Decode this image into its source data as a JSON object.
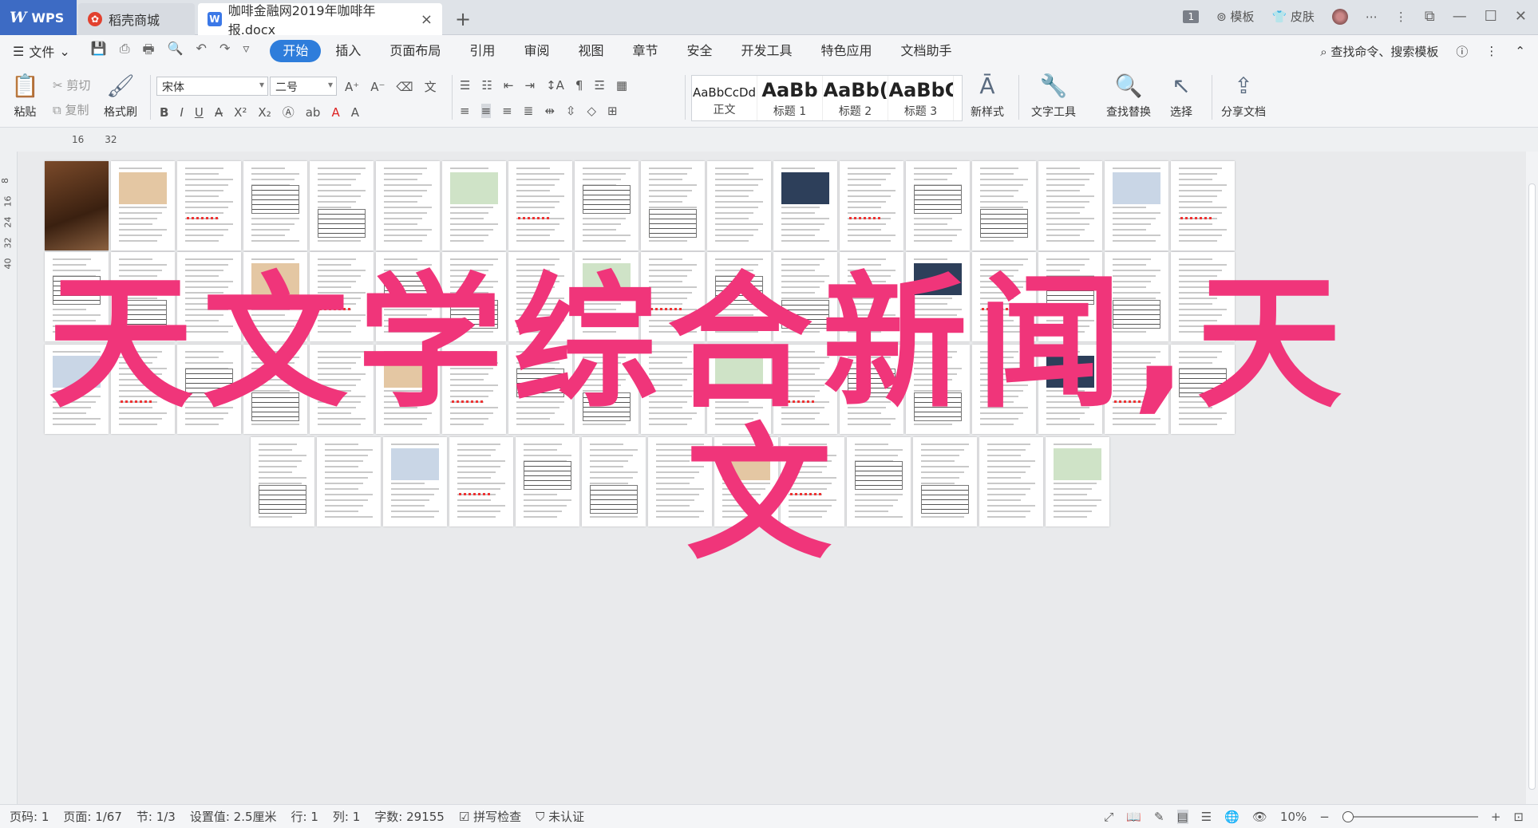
{
  "tabs": [
    {
      "label": "WPS",
      "icon": "wps-logo-icon"
    },
    {
      "label": "稻壳商城",
      "icon": "docer-icon"
    },
    {
      "label": "咖啡金融网2019年咖啡年报.docx",
      "icon": "word-doc-icon"
    }
  ],
  "titlebar_right": {
    "badge": "1",
    "template": "模板",
    "skin": "皮肤"
  },
  "menu": {
    "file": "文件",
    "items": [
      "开始",
      "插入",
      "页面布局",
      "引用",
      "审阅",
      "视图",
      "章节",
      "安全",
      "开发工具",
      "特色应用",
      "文档助手"
    ],
    "active": "开始",
    "search": "查找命令、搜索模板"
  },
  "ribbon": {
    "paste": "粘贴",
    "cut": "剪切",
    "copy": "复制",
    "format_painter": "格式刷",
    "font_name": "宋体",
    "font_size": "二号",
    "styles": [
      {
        "sample": "AaBbCcDd",
        "name": "正文"
      },
      {
        "sample": "AaBb",
        "name": "标题 1"
      },
      {
        "sample": "AaBb(",
        "name": "标题 2"
      },
      {
        "sample": "AaBbC",
        "name": "标题 3"
      }
    ],
    "new_style": "新样式",
    "text_tools": "文字工具",
    "find_replace": "查找替换",
    "select": "选择",
    "share": "分享文档"
  },
  "ruler": {
    "h_marks": [
      "16",
      "32"
    ],
    "v_marks": [
      "8",
      "16",
      "24",
      "32",
      "40"
    ]
  },
  "overlay": {
    "line1": "天文学综合新闻,天",
    "line2": "文"
  },
  "status": {
    "page_num": "页码: 1",
    "page": "页面: 1/67",
    "section": "节: 1/3",
    "setting": "设置值: 2.5厘米",
    "row": "行: 1",
    "col": "列: 1",
    "words": "字数: 29155",
    "spell": "拼写检查",
    "auth": "未认证",
    "zoom": "10%"
  },
  "colors": {
    "accent": "#2e7ddb",
    "overlay": "#f0357a",
    "wps_blue": "#3d6bc4"
  }
}
